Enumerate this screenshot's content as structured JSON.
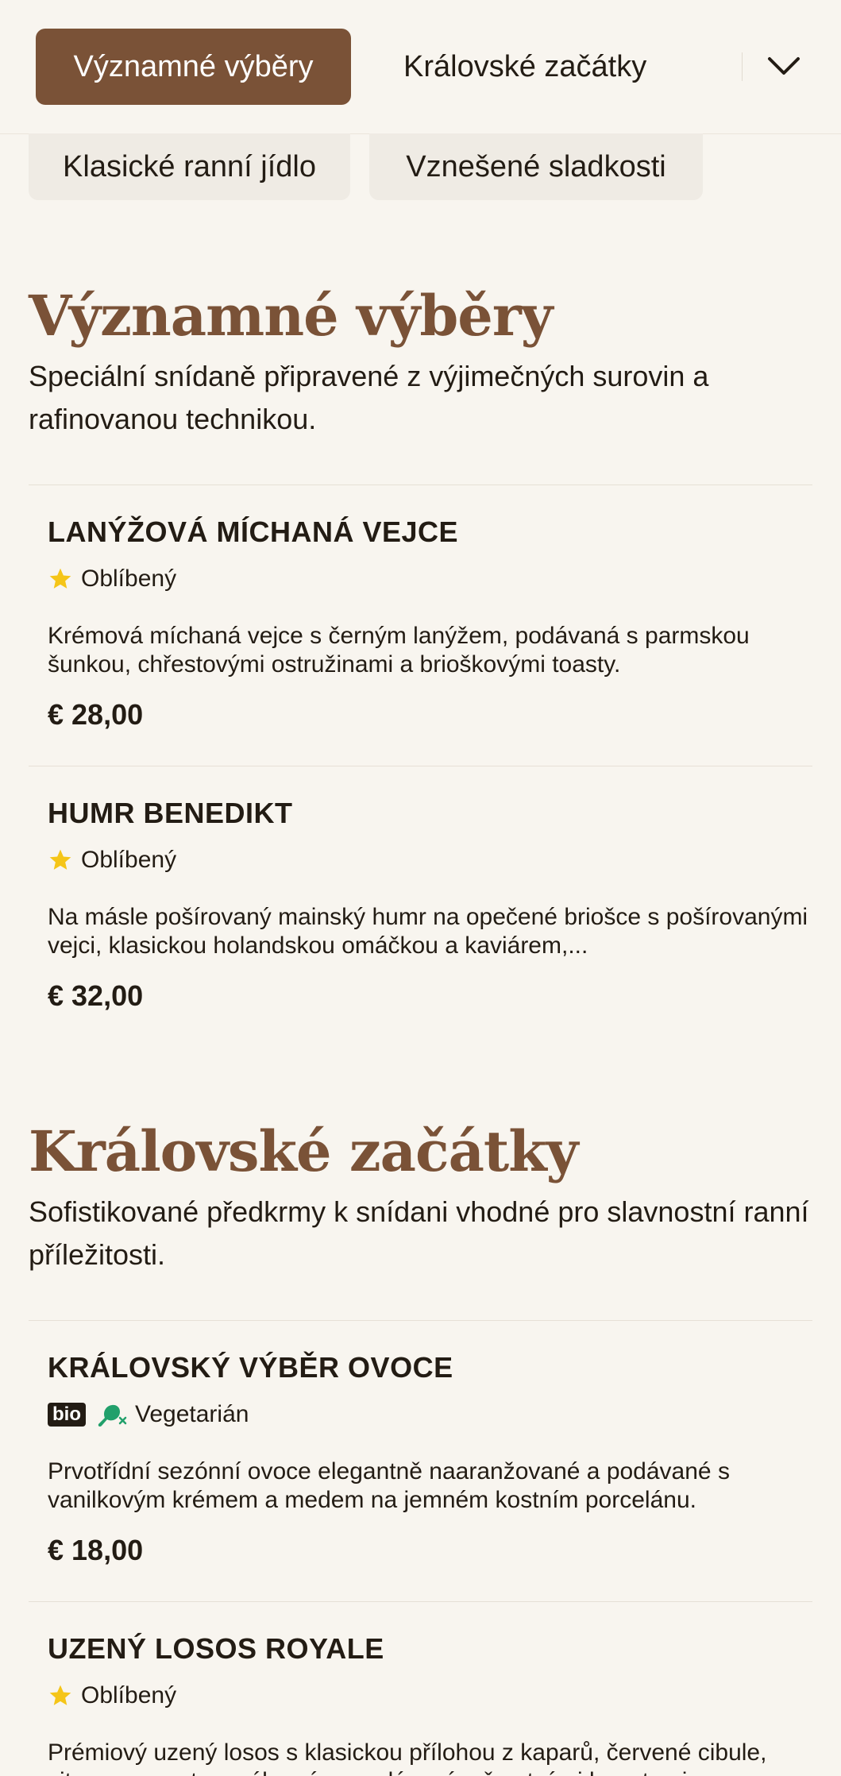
{
  "nav": {
    "active_tab": "Významné výběry",
    "tabs": [
      "Královské začátky"
    ],
    "secondary_tabs": [
      "Klasické ranní jídlo",
      "Vznešené sladkosti"
    ]
  },
  "sections": [
    {
      "title": "Významné výběry",
      "description": "Speciální snídaně připravené z výjimečných surovin a rafinovanou technikou.",
      "items": [
        {
          "name": "LANÝŽOVÁ MÍCHANÁ VEJCE",
          "tag": "Oblíbený",
          "description": "Krémová míchaná vejce s černým lanýžem, podávaná s parmskou šunkou, chřestovými ostružinami a brioškovými toasty.",
          "price": "€ 28,00"
        },
        {
          "name": "HUMR BENEDIKT",
          "tag": "Oblíbený",
          "description": "Na másle pošírovaný mainský humr na opečené briošce s pošírovanými vejci, klasickou holandskou omáčkou a kaviárem,...",
          "price": "€ 32,00"
        }
      ]
    },
    {
      "title": "Královské začátky",
      "description": "Sofistikované předkrmy k snídani vhodné pro slavnostní ranní příležitosti.",
      "items": [
        {
          "name": "KRÁLOVSKÝ VÝBĚR OVOCE",
          "badge": "bio",
          "tag": "Vegetarián",
          "description": "Prvotřídní sezónní ovoce elegantně naaranžované a podávané s vanilkovým krémem a medem na jemném kostním porcelánu.",
          "price": "€ 18,00"
        },
        {
          "name": "UZENÝ LOSOS ROYALE",
          "tag": "Oblíbený",
          "description": "Prémiový uzený losos s klasickou přílohou z kaparů, červené cibule, citronu a smetanového sýra, podávaný s čerstvými bagetami.",
          "price": ""
        }
      ]
    }
  ],
  "icons": {
    "star": "star-icon",
    "vegetarian": "no-meat-icon",
    "chevron": "chevron-down-icon"
  },
  "colors": {
    "accent": "#7a5237",
    "star": "#f5c518",
    "vegetarian": "#22a06b",
    "background": "#f8f5ef"
  }
}
